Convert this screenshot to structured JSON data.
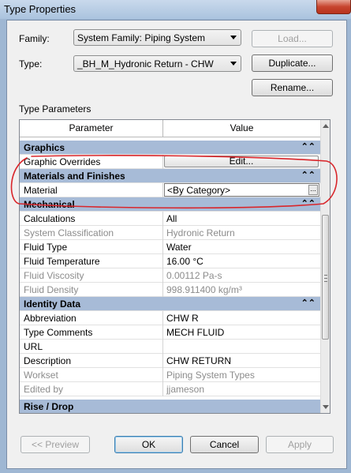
{
  "window": {
    "title": "Type Properties"
  },
  "family": {
    "label": "Family:",
    "value": "System Family: Piping System"
  },
  "type": {
    "label": "Type:",
    "value": "_BH_M_Hydronic Return - CHW"
  },
  "buttons": {
    "load": "Load...",
    "duplicate": "Duplicate...",
    "rename": "Rename...",
    "preview": "<< Preview",
    "ok": "OK",
    "cancel": "Cancel",
    "apply": "Apply"
  },
  "type_parameters_label": "Type Parameters",
  "grid": {
    "headers": {
      "parameter": "Parameter",
      "value": "Value"
    },
    "group_toggle_icon": "collapse-chevrons-up",
    "graphics": {
      "title": "Graphics",
      "rows": [
        {
          "name": "Graphic Overrides",
          "value": "Edit..."
        }
      ]
    },
    "materials": {
      "title": "Materials and Finishes",
      "rows": [
        {
          "name": "Material",
          "value": "<By Category>"
        }
      ]
    },
    "mechanical": {
      "title": "Mechanical",
      "rows": [
        {
          "name": "Calculations",
          "value": "All"
        },
        {
          "name": "System Classification",
          "value": "Hydronic Return"
        },
        {
          "name": "Fluid Type",
          "value": "Water"
        },
        {
          "name": "Fluid Temperature",
          "value": "16.00 °C"
        },
        {
          "name": "Fluid Viscosity",
          "value": "0.00112 Pa-s"
        },
        {
          "name": "Fluid Density",
          "value": "998.911400 kg/m³"
        }
      ]
    },
    "identity": {
      "title": "Identity Data",
      "rows": [
        {
          "name": "Abbreviation",
          "value": "CHW R"
        },
        {
          "name": "Type Comments",
          "value": "MECH FLUID"
        },
        {
          "name": "URL",
          "value": ""
        },
        {
          "name": "Description",
          "value": "CHW RETURN"
        },
        {
          "name": "Workset",
          "value": "Piping System Types"
        },
        {
          "name": "Edited by",
          "value": "jjameson"
        }
      ]
    },
    "rise_drop": {
      "title": "Rise / Drop"
    }
  },
  "colors": {
    "group_header": "#a7bbd7",
    "annotation": "#d9262b"
  }
}
